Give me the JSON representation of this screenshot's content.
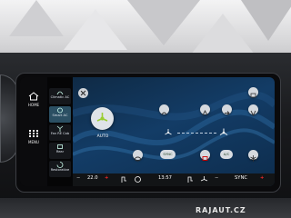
{
  "sidebar": {
    "home_label": "HOME",
    "menu_label": "MENU"
  },
  "tabs": [
    {
      "label": "Climatic AC",
      "icon": "climate-icon"
    },
    {
      "label": "Smart AC",
      "icon": "smart-ac-icon",
      "active": true
    },
    {
      "label": "Fan\nRE Cab",
      "icon": "fan-icon"
    },
    {
      "label": "Rear",
      "icon": "rear-icon"
    },
    {
      "label": "Restorative",
      "icon": "restore-icon"
    }
  ],
  "climate": {
    "auto_label": "AUTO",
    "sync_label": "SYNC",
    "ac_label": "A/C"
  },
  "bottom_bar": {
    "left_temp": "22.0",
    "minus": "−",
    "plus": "+",
    "time": "13:57",
    "sync_label": "SYNC"
  },
  "watermark": "RAJAUT.CZ"
}
